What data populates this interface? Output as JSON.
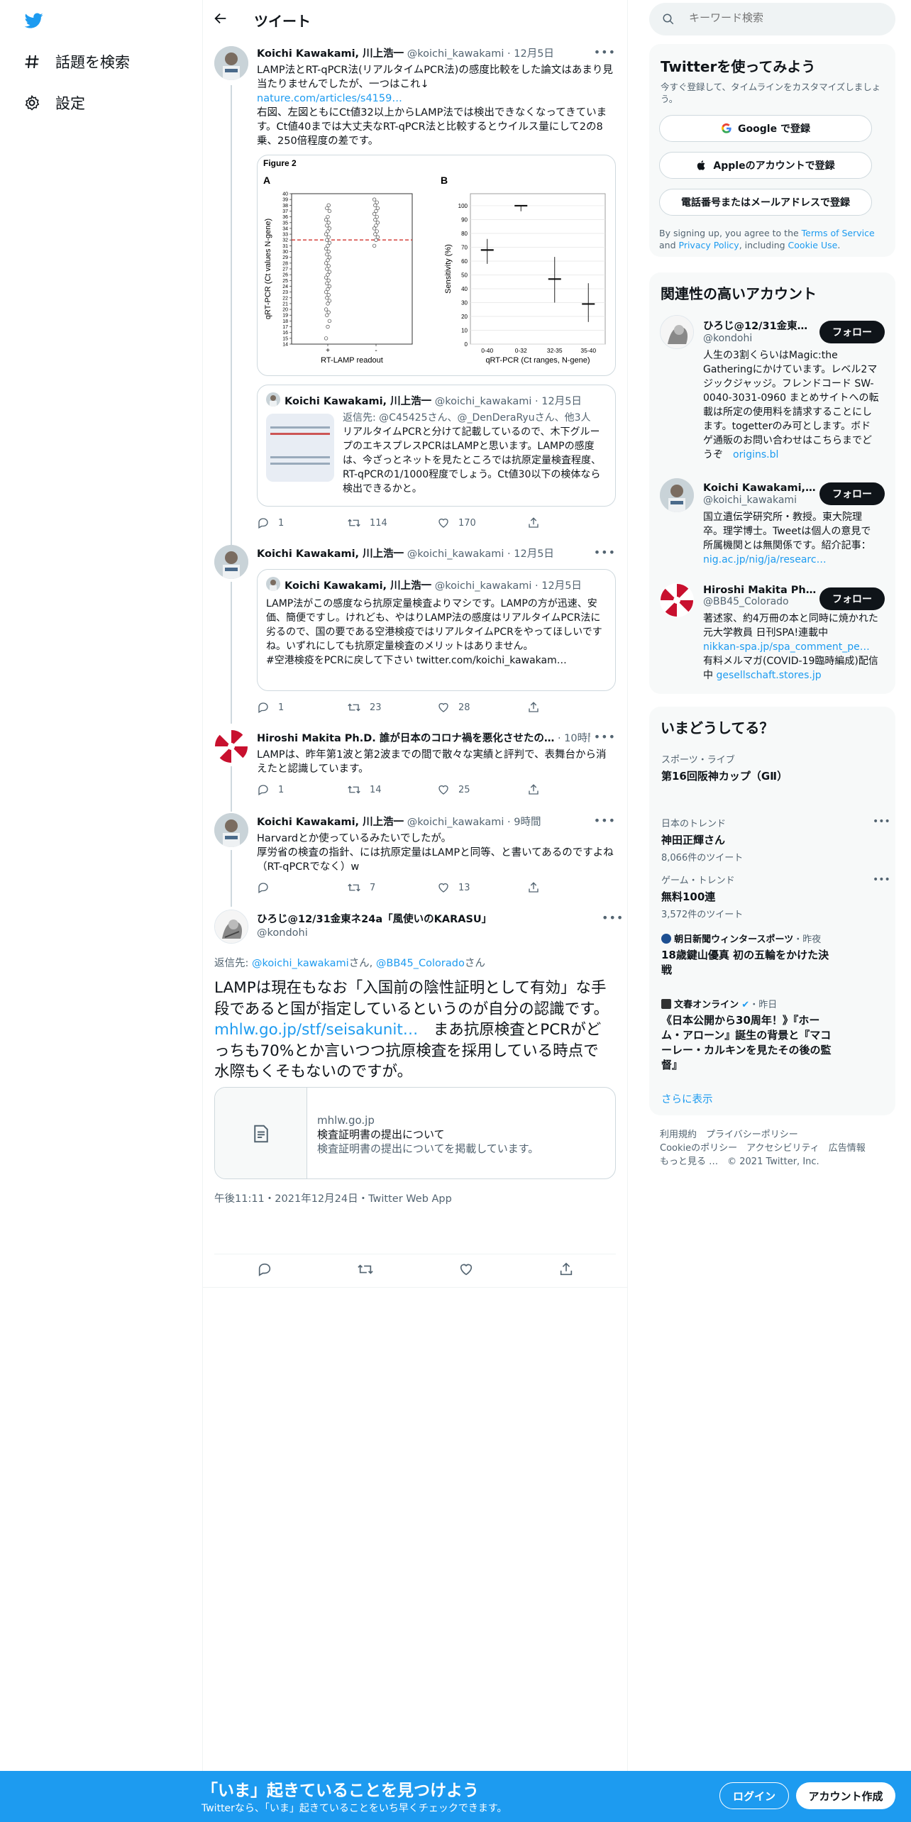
{
  "nav": {
    "explore_label": "話題を検索",
    "settings_label": "設定"
  },
  "header": {
    "title": "ツイート"
  },
  "search": {
    "placeholder": "キーワード検索"
  },
  "tweets": [
    {
      "name": "Koichi Kawakami, 川上浩一",
      "handle": "@koichi_kawakami",
      "time": "12月5日",
      "text1": "LAMP法とRT-qPCR法(リアルタイムPCR法)の感度比較をした論文はあまり見当たりませんでしたが、一つはこれ↓",
      "link": "nature.com/articles/s4159…",
      "text2": "右図、左図ともにCt値32以上からLAMP法では検出できなくなってきています。Ct値40までは大丈夫なRT-qPCR法と比較するとウイルス量にして2の8乗、250倍程度の差です。",
      "replies": "1",
      "retweets": "114",
      "likes": "170",
      "quote": {
        "name": "Koichi Kawakami, 川上浩一",
        "handle": "@koichi_kawakami",
        "time": "12月5日",
        "reply_to": "返信先: @C45425さん、@_DenDeraRyuさん、他3人",
        "text": "リアルタイムPCRと分けて記載しているので、木下グループのエキスプレスPCRはLAMPと思います。LAMPの感度は、今ざっとネットを見たところでは抗原定量検査程度、RT-qPCRの1/1000程度でしょう。Ct値30以下の検体なら検出できるかと。"
      }
    },
    {
      "name": "Koichi Kawakami, 川上浩一",
      "handle": "@koichi_kawakami",
      "time": "12月5日",
      "replies": "1",
      "retweets": "23",
      "likes": "28",
      "quote": {
        "name": "Koichi Kawakami, 川上浩一",
        "handle": "@koichi_kawakami",
        "time": "12月5日",
        "text": "LAMP法がこの感度なら抗原定量検査よりマシです。LAMPの方が迅速、安価、簡便ですし。けれども、やはりLAMP法の感度はリアルタイムPCR法に劣るので、国の要である空港検疫ではリアルタイムPCRをやってほしいですね。いずれにしても抗原定量検査のメリットはありません。",
        "text2": "#空港検疫をPCRに戻して下さい twitter.com/koichi_kawakam…"
      }
    },
    {
      "name": "Hiroshi Makita Ph.D. 誰が日本のコロナ禍を悪化させたの…",
      "time": "10時間",
      "text": "LAMPは、昨年第1波と第2波までの間で散々な実績と評判で、表舞台から消えたと認識しています。",
      "replies": "1",
      "retweets": "14",
      "likes": "25"
    },
    {
      "name": "Koichi Kawakami, 川上浩一",
      "handle": "@koichi_kawakami",
      "time": "9時間",
      "text": "Harvardとか使っているみたいでしたが。\n厚労省の検査の指針、には抗原定量はLAMPと同等、と書いてあるのですよね（RT-qPCRでなく）w",
      "replies": "",
      "retweets": "7",
      "likes": "13"
    }
  ],
  "main_tweet": {
    "name": "ひろじ@12/31金東ネ24a「風使いのKARASU」",
    "handle": "@kondohi",
    "reply_prefix": "返信先: ",
    "reply_user1": "@koichi_kawakami",
    "reply_mid": "さん, ",
    "reply_user2": "@BB45_Colorado",
    "reply_suffix": "さん",
    "text_a": "LAMPは現在もなお「入国前の陰性証明として有効」な手段であると国が指定しているというのが自分の認識です。",
    "link": "mhlw.go.jp/stf/seisakunit…",
    "text_b": "　まあ抗原検査とPCRがどっちも70%とか言いつつ抗原検査を採用している時点で水際もくそもないのですが。",
    "card_domain": "mhlw.go.jp",
    "card_title": "検査証明書の提出について",
    "card_desc": "検査証明書の提出についてを掲載しています。",
    "timestamp": "午後11:11・2021年12月24日・Twitter Web App"
  },
  "figure": {
    "title": "Figure 2",
    "panel_a": "A",
    "panel_b": "B",
    "a_ylabel": "qRT-PCR (Ct values N-gene)",
    "a_xlabel": "RT-LAMP readout",
    "a_x_plus": "+",
    "a_x_minus": "-",
    "b_ylabel": "Sensitivity (%)",
    "b_xlabel": "qRT-PCR (Ct ranges, N-gene)"
  },
  "chart_data": [
    {
      "type": "scatter",
      "title": "A",
      "xlabel": "RT-LAMP readout",
      "ylabel": "qRT-PCR (Ct values N-gene)",
      "categories": [
        "+",
        "-"
      ],
      "ylim": [
        14,
        40
      ],
      "yticks": [
        14,
        15,
        16,
        17,
        18,
        19,
        20,
        21,
        22,
        23,
        24,
        25,
        26,
        27,
        28,
        29,
        30,
        31,
        32,
        33,
        34,
        35,
        36,
        37,
        38,
        39,
        40
      ],
      "threshold": 32,
      "series": [
        {
          "values": [
            15,
            17,
            18,
            19,
            19.5,
            20,
            21,
            21.5,
            22,
            22.5,
            23,
            23.5,
            24,
            24.5,
            25,
            25.5,
            26,
            26.5,
            27,
            27.5,
            28,
            28.5,
            29,
            29.5,
            30,
            30.5,
            31,
            31.5,
            32,
            32.5,
            33,
            33.5,
            34,
            34.5,
            35,
            35.5,
            36,
            37,
            37.5,
            38
          ]
        },
        {
          "values": [
            31,
            32,
            32.5,
            33,
            33.5,
            34,
            34.5,
            35,
            35.5,
            36,
            36.5,
            37,
            37.5,
            38,
            38.5,
            39
          ]
        }
      ]
    },
    {
      "type": "scatter",
      "title": "B",
      "xlabel": "qRT-PCR (Ct ranges, N-gene)",
      "ylabel": "Sensitivity (%)",
      "categories": [
        "0-40",
        "0-32",
        "32-35",
        "35-40"
      ],
      "ylim": [
        0,
        100
      ],
      "yticks": [
        0,
        10,
        20,
        30,
        40,
        50,
        60,
        70,
        80,
        90,
        100
      ],
      "values": [
        68,
        100,
        47,
        29
      ],
      "err_low": [
        58,
        96,
        30,
        16
      ],
      "err_high": [
        76,
        100,
        63,
        44
      ]
    }
  ],
  "signup": {
    "title": "Twitterを使ってみよう",
    "subtitle": "今すぐ登録して、タイムラインをカスタマイズしましょう。",
    "google": "Google で登録",
    "apple": "Appleのアカウントで登録",
    "phone": "電話番号またはメールアドレスで登録",
    "terms_a": "By signing up, you agree to the ",
    "terms_link1": "Terms of Service",
    "terms_b": " and ",
    "terms_link2": "Privacy Policy",
    "terms_c": ", including ",
    "terms_link3": "Cookie Use",
    "terms_d": "."
  },
  "relevant": {
    "title": "関連性の高いアカウント",
    "follow_label": "フォロー",
    "accounts": [
      {
        "name": "ひろじ@12/31金東ネ…",
        "handle": "@kondohi",
        "bio": "人生の3割くらいはMagic:the Gatheringにかけています。レベル2マジックジャッジ。フレンドコード SW-0040-3031-0960 まとめサイトへの転載は所定の使用料を請求することにします。togetterのみ可とします。ボドゲ通販のお問い合わせはこちらまでどうぞ",
        "bio_link": "origins.bl"
      },
      {
        "name": "Koichi Kawakami, 川…",
        "handle": "@koichi_kawakami",
        "bio": "国立遺伝学研究所・教授。東大院理卒。理学博士。Tweetは個人の意見で所属機関とは無関係です。紹介記事：",
        "bio_link": "nig.ac.jp/nig/ja/researc…"
      },
      {
        "name": "Hiroshi Makita Ph.D. …",
        "handle": "@BB45_Colorado",
        "bio": "著述家、約4万冊の本と同時に焼かれた元大学教員 日刊SPA!連載中",
        "bio_link": "nikkan-spa.jp/spa_comment_pe…",
        "bio2": " 有料メルマガ(COVID-19臨時編成)配信中 ",
        "bio_link2": "gesellschaft.stores.jp"
      }
    ]
  },
  "trends": {
    "title": "いまどうしてる？",
    "items": [
      {
        "category": "スポーツ・ライブ",
        "title": "第16回阪神カップ（GⅡ）"
      },
      {
        "category": "日本のトレンド",
        "title": "神田正輝さん",
        "count": "8,066件のツイート"
      },
      {
        "category": "ゲーム・トレンド",
        "title": "無料100連",
        "count": "3,572件のツイート"
      },
      {
        "source": "朝日新聞ウィンタースポーツ",
        "time": "・昨夜",
        "title": "18歳鍵山優真 初の五輪をかけた決戦"
      },
      {
        "source": "文春オンライン",
        "time": "・昨日",
        "title": "《日本公開から30周年！》『ホーム・アローン』誕生の背景と『マコーレー・カルキンを見たその後の監督』"
      }
    ],
    "show_more": "さらに表示"
  },
  "footer_links": {
    "line1": "利用規約　プライバシーポリシー",
    "line2": "Cookieのポリシー　アクセシビリティ　広告情報",
    "line3": "もっと見る …　© 2021 Twitter, Inc."
  },
  "bottom_bar": {
    "title": "「いま」起きていることを見つけよう",
    "subtitle": "Twitterなら、「いま」起きていることをいち早くチェックできます。",
    "login": "ログイン",
    "signup": "アカウント作成"
  },
  "colors": {
    "accent": "#1d9bf0",
    "text": "#0f1419",
    "muted": "#536471",
    "border": "#eff3f4",
    "threshold": "#d0312d"
  }
}
